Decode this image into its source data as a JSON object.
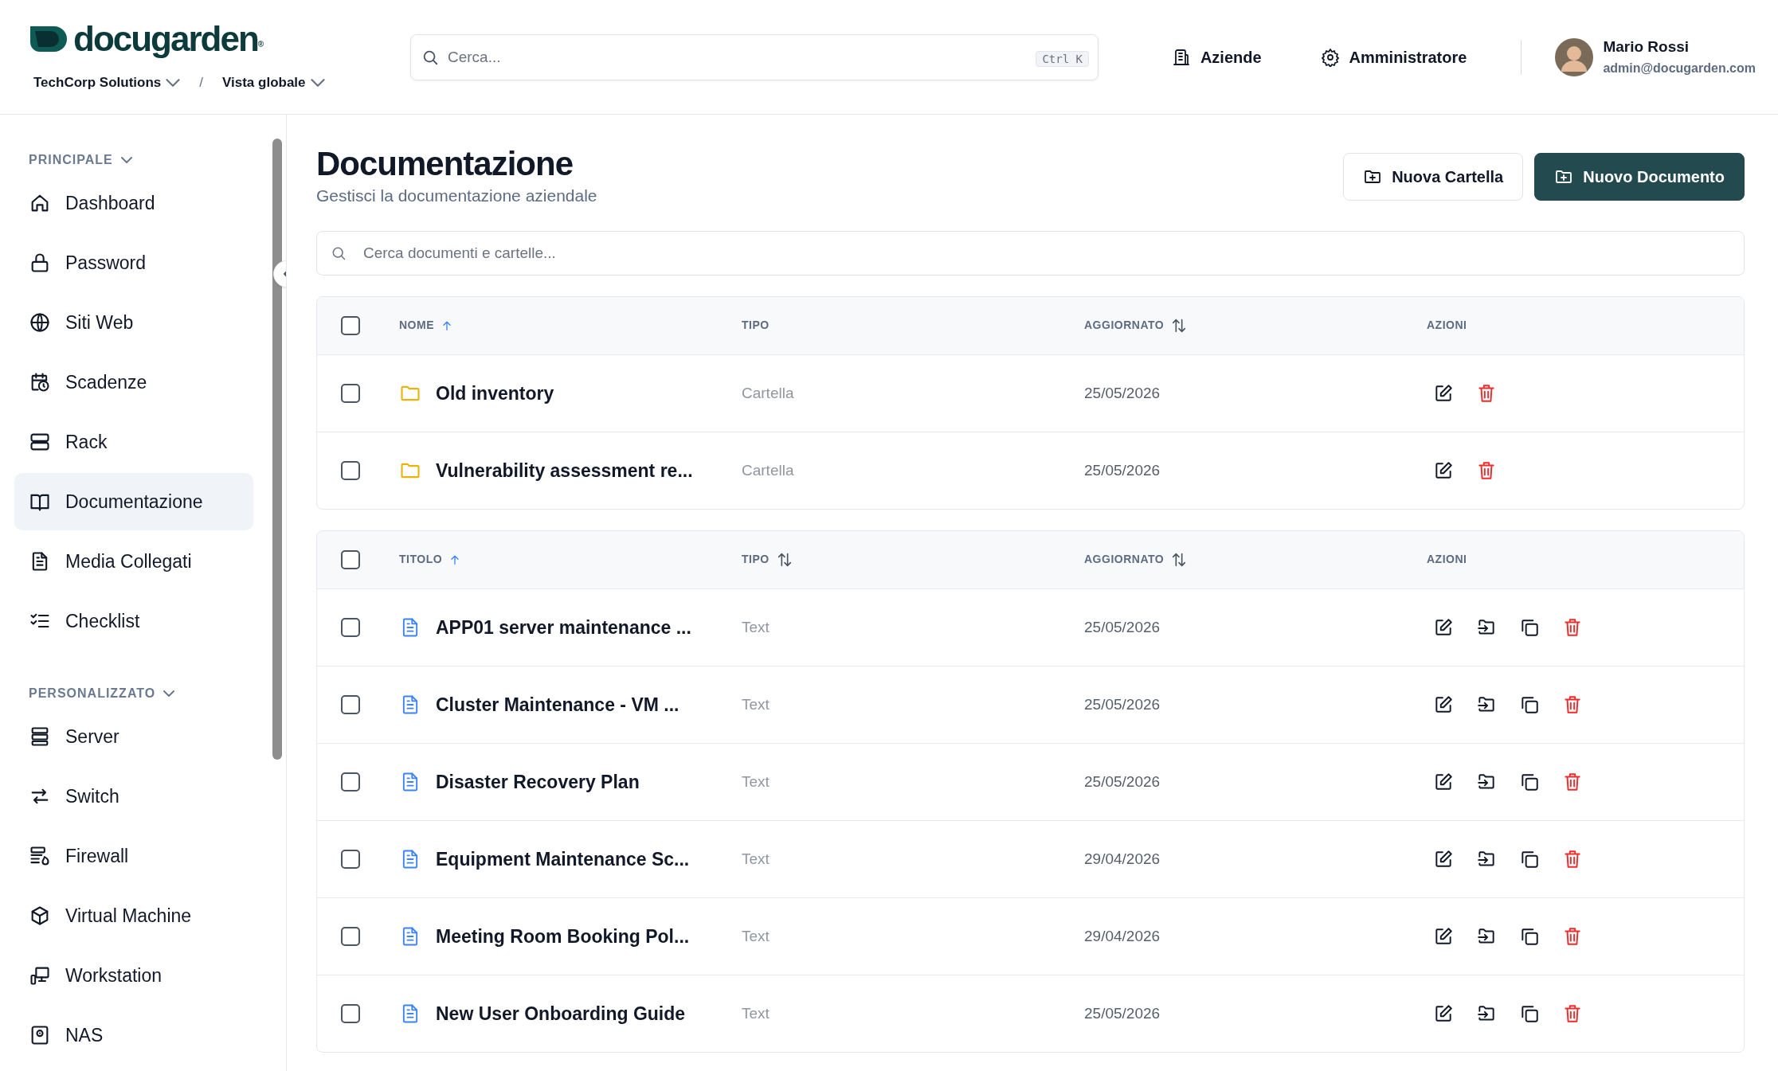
{
  "header": {
    "logo": "docugarden",
    "logo_mark": "®",
    "breadcrumb": [
      {
        "label": "TechCorp Solutions"
      },
      {
        "label": "Vista globale"
      }
    ],
    "breadcrumb_separator": "/",
    "search": {
      "placeholder": "Cerca...",
      "shortcut": "Ctrl K"
    },
    "nav": [
      {
        "label": "Aziende"
      },
      {
        "label": "Amministratore"
      }
    ],
    "user": {
      "name": "Mario Rossi",
      "email": "admin@docugarden.com"
    }
  },
  "sidebar": {
    "sections": [
      {
        "title": "PRINCIPALE",
        "expanded": true,
        "items": [
          {
            "label": "Dashboard",
            "selected": false
          },
          {
            "label": "Password",
            "selected": false
          },
          {
            "label": "Siti Web",
            "selected": false
          },
          {
            "label": "Scadenze",
            "selected": false
          },
          {
            "label": "Rack",
            "selected": false
          },
          {
            "label": "Documentazione",
            "selected": true
          },
          {
            "label": "Media Collegati",
            "selected": false
          },
          {
            "label": "Checklist",
            "selected": false
          }
        ]
      },
      {
        "title": "PERSONALIZZATO",
        "expanded": true,
        "items": [
          {
            "label": "Server",
            "selected": false
          },
          {
            "label": "Switch",
            "selected": false
          },
          {
            "label": "Firewall",
            "selected": false
          },
          {
            "label": "Virtual Machine",
            "selected": false
          },
          {
            "label": "Workstation",
            "selected": false
          },
          {
            "label": "NAS",
            "selected": false
          }
        ]
      }
    ]
  },
  "page": {
    "title": "Documentazione",
    "subtitle": "Gestisci la documentazione aziendale",
    "buttons": [
      {
        "label": "Nuova Cartella",
        "kind": "secondary"
      },
      {
        "label": "Nuovo Documento",
        "kind": "primary"
      }
    ],
    "search": {
      "placeholder": "Cerca documenti e cartelle..."
    }
  },
  "tables": [
    {
      "columns": [
        {
          "label": "NOME",
          "sorted_ascending": true,
          "sortable": false
        },
        {
          "label": "TIPO",
          "sorted_ascending": false,
          "sortable": false
        },
        {
          "label": "AGGIORNATO",
          "sorted_ascending": false,
          "sortable": true
        },
        {
          "label": "AZIONI",
          "sorted_ascending": false,
          "sortable": false
        }
      ],
      "all_checked": false,
      "rows": [
        {
          "kind": "folder",
          "name": "Old inventory",
          "type": "Cartella",
          "updated": "25/05/2026",
          "checked": false,
          "actions": [
            {
              "kind": "edit"
            },
            {
              "kind": "delete"
            }
          ]
        },
        {
          "kind": "folder",
          "name": "Vulnerability assessment re...",
          "type": "Cartella",
          "updated": "25/05/2026",
          "checked": false,
          "actions": [
            {
              "kind": "edit"
            },
            {
              "kind": "delete"
            }
          ]
        }
      ]
    },
    {
      "columns": [
        {
          "label": "TITOLO",
          "sorted_ascending": true,
          "sortable": false
        },
        {
          "label": "TIPO",
          "sorted_ascending": false,
          "sortable": true
        },
        {
          "label": "AGGIORNATO",
          "sorted_ascending": false,
          "sortable": true
        },
        {
          "label": "AZIONI",
          "sorted_ascending": false,
          "sortable": false
        }
      ],
      "all_checked": false,
      "rows": [
        {
          "kind": "document",
          "name": "APP01 server maintenance ...",
          "type": "Text",
          "updated": "25/05/2026",
          "checked": false,
          "actions": [
            {
              "kind": "edit"
            },
            {
              "kind": "move"
            },
            {
              "kind": "copy"
            },
            {
              "kind": "delete"
            }
          ]
        },
        {
          "kind": "document",
          "name": "Cluster Maintenance - VM ...",
          "type": "Text",
          "updated": "25/05/2026",
          "checked": false,
          "actions": [
            {
              "kind": "edit"
            },
            {
              "kind": "move"
            },
            {
              "kind": "copy"
            },
            {
              "kind": "delete"
            }
          ]
        },
        {
          "kind": "document",
          "name": "Disaster Recovery Plan",
          "type": "Text",
          "updated": "25/05/2026",
          "checked": false,
          "actions": [
            {
              "kind": "edit"
            },
            {
              "kind": "move"
            },
            {
              "kind": "copy"
            },
            {
              "kind": "delete"
            }
          ]
        },
        {
          "kind": "document",
          "name": "Equipment Maintenance Sc...",
          "type": "Text",
          "updated": "29/04/2026",
          "checked": false,
          "actions": [
            {
              "kind": "edit"
            },
            {
              "kind": "move"
            },
            {
              "kind": "copy"
            },
            {
              "kind": "delete"
            }
          ]
        },
        {
          "kind": "document",
          "name": "Meeting Room Booking Pol...",
          "type": "Text",
          "updated": "29/04/2026",
          "checked": false,
          "actions": [
            {
              "kind": "edit"
            },
            {
              "kind": "move"
            },
            {
              "kind": "copy"
            },
            {
              "kind": "delete"
            }
          ]
        },
        {
          "kind": "document",
          "name": "New User Onboarding Guide",
          "type": "Text",
          "updated": "25/05/2026",
          "checked": false,
          "actions": [
            {
              "kind": "edit"
            },
            {
              "kind": "move"
            },
            {
              "kind": "copy"
            },
            {
              "kind": "delete"
            }
          ]
        }
      ]
    }
  ]
}
